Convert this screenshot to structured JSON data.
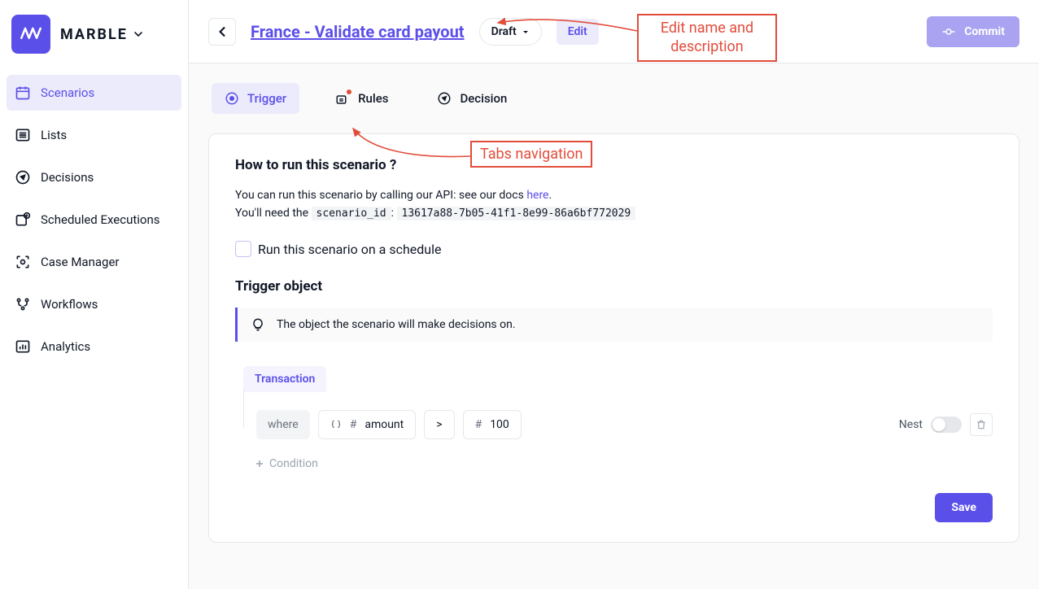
{
  "brand": {
    "name": "MARBLE"
  },
  "sidebar": {
    "items": [
      {
        "label": "Scenarios",
        "icon": "calendar-icon",
        "active": true
      },
      {
        "label": "Lists",
        "icon": "list-icon"
      },
      {
        "label": "Decisions",
        "icon": "compass-icon"
      },
      {
        "label": "Scheduled Executions",
        "icon": "clock-box-icon"
      },
      {
        "label": "Case Manager",
        "icon": "scan-icon"
      },
      {
        "label": "Workflows",
        "icon": "flow-icon"
      },
      {
        "label": "Analytics",
        "icon": "chart-icon"
      }
    ]
  },
  "header": {
    "title": "France - Validate card payout",
    "status_label": "Draft",
    "edit_label": "Edit",
    "commit_label": "Commit"
  },
  "tabs": [
    {
      "label": "Trigger",
      "icon": "target-icon",
      "active": true
    },
    {
      "label": "Rules",
      "icon": "rules-icon",
      "badge": true
    },
    {
      "label": "Decision",
      "icon": "compass-icon"
    }
  ],
  "panel": {
    "run_heading": "How to run this scenario ?",
    "run_desc_prefix": "You can run this scenario by calling our API: see our docs ",
    "run_desc_link": "here",
    "run_desc_suffix": ".",
    "id_prefix": "You'll need the ",
    "id_label": "scenario_id",
    "id_sep": ": ",
    "id_value": "13617a88-7b05-41f1-8e99-86a6bf772029",
    "schedule_label": "Run this scenario on a schedule",
    "trigger_heading": "Trigger object",
    "callout": "The object the scenario will make decisions on.",
    "object_label": "Transaction",
    "where_label": "where",
    "field_label": "amount",
    "operator_label": ">",
    "value_label": "100",
    "nest_label": "Nest",
    "add_condition_label": "Condition",
    "save_label": "Save"
  },
  "annotations": {
    "edit_name": "Edit name and description",
    "tabs_nav": "Tabs navigation"
  },
  "colors": {
    "accent": "#5B4FE9",
    "accent_soft": "#ecebfc",
    "anno": "#e24d3b"
  }
}
